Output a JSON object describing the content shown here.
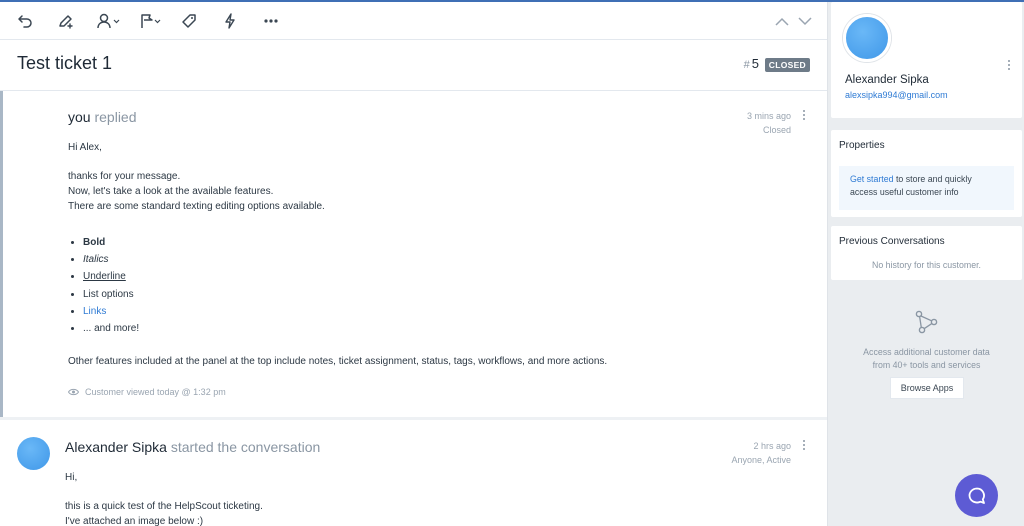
{
  "ticket": {
    "title": "Test ticket 1",
    "hash": "#",
    "number": "5",
    "status": "CLOSED"
  },
  "toolbar": {
    "icons": [
      "undo-icon",
      "note-icon",
      "assign-icon",
      "status-flag-icon",
      "tag-icon",
      "workflow-icon",
      "more-icon",
      "previous-icon",
      "next-icon"
    ]
  },
  "threads": [
    {
      "author": "you",
      "verb": "replied",
      "time": "3 mins ago",
      "status": "Closed",
      "greeting": "Hi Alex,",
      "lines": [
        "thanks for your message.",
        "Now, let's take a look at the available features.",
        "There are some standard texting editing options available."
      ],
      "list": [
        "Bold",
        "Italics",
        "Underline",
        "List options",
        "Links",
        "... and more!"
      ],
      "closing": "Other features included at the panel at the top include notes, ticket assignment, status, tags, workflows, and more actions.",
      "viewed": "Customer viewed today @ 1:32 pm"
    },
    {
      "author": "Alexander Sipka",
      "verb": "started the conversation",
      "time": "2 hrs ago",
      "status": "Anyone, Active",
      "greeting": "Hi,",
      "lines": [
        "this is a quick test of the HelpScout ticketing.",
        "I've attached an image below :)"
      ]
    }
  ],
  "customer": {
    "name": "Alexander Sipka",
    "email": "alexsipka994@gmail.com"
  },
  "properties": {
    "title": "Properties",
    "link": "Get started",
    "text_line1": " to store and quickly",
    "text_line2": "access useful customer info"
  },
  "previous": {
    "title": "Previous Conversations",
    "empty": "No history for this customer."
  },
  "apps": {
    "line1": "Access additional customer data",
    "line2": "from 40+ tools and services",
    "button": "Browse Apps"
  },
  "colors": {
    "accent": "#2f7bd4",
    "badge": "#6e7b88",
    "beacon": "#5d5bd4"
  }
}
